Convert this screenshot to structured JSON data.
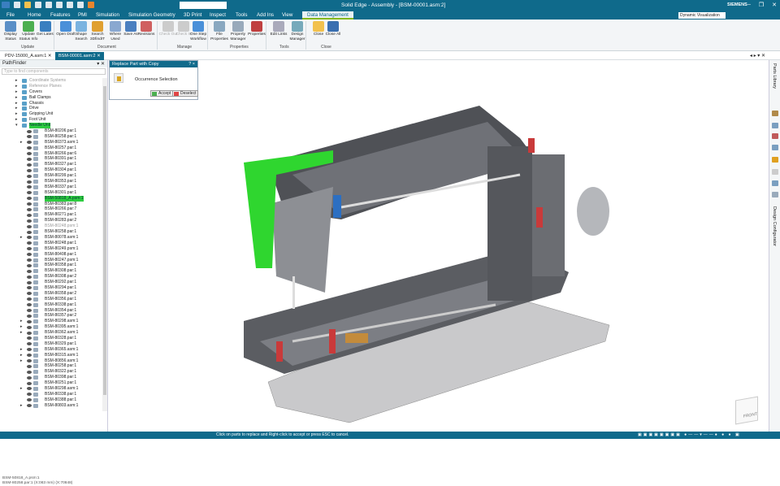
{
  "app": {
    "title": "Solid Edge - Assembly - [BSM-00001.asm:2]",
    "brand": "SIEMENS",
    "quick_search_value": ""
  },
  "menu_tabs": [
    "File",
    "Home",
    "Features",
    "PMI",
    "Simulation",
    "Simulation Geometry",
    "3D Print",
    "Inspect",
    "Tools",
    "Add Ins",
    "View",
    "Data Management"
  ],
  "active_tab": "Data Management",
  "dynamic_visualization": "Dynamic Visualization",
  "ribbon": {
    "buttons": [
      {
        "label": "Display Status",
        "icon": "display-status-icon"
      },
      {
        "label": "Update Status Info",
        "icon": "update-icon"
      },
      {
        "label": "Get Latest",
        "icon": "get-latest-icon"
      },
      {
        "label": "Open Draft",
        "icon": "open-draft-icon"
      },
      {
        "label": "Shape Search",
        "icon": "shape-search-icon"
      },
      {
        "label": "Search 3DfindIT",
        "icon": "3dfindit-icon"
      },
      {
        "label": "Where Used",
        "icon": "where-used-icon"
      },
      {
        "label": "Save As",
        "icon": "save-as-icon"
      },
      {
        "label": "Revisions",
        "icon": "revisions-icon"
      },
      {
        "label": "Check Out",
        "icon": "check-out-icon",
        "disabled": true
      },
      {
        "label": "Check In",
        "icon": "check-in-icon",
        "disabled": true
      },
      {
        "label": "One Step Workflow",
        "icon": "workflow-icon"
      },
      {
        "label": "File Properties",
        "icon": "file-properties-icon"
      },
      {
        "label": "Property Manager",
        "icon": "property-manager-icon"
      },
      {
        "label": "Properties",
        "icon": "properties-icon"
      },
      {
        "label": "Edit Links",
        "icon": "edit-links-icon"
      },
      {
        "label": "Design Manager",
        "icon": "design-manager-icon"
      },
      {
        "label": "Close",
        "icon": "close-folder-icon"
      },
      {
        "label": "Close All",
        "icon": "close-all-icon"
      }
    ],
    "groups": [
      "Update",
      "Document",
      "Manage",
      "Properties",
      "Tools",
      "Close"
    ]
  },
  "doc_tabs": [
    "PDV-15000_A.asm:1",
    "BSM-00001.asm:2"
  ],
  "pathfinder": {
    "title": "PathFinder",
    "search_placeholder": "Type to find components",
    "top_items": [
      {
        "label": "Coordinate Systems",
        "dim": true
      },
      {
        "label": "Reference Planes",
        "dim": true
      },
      {
        "label": "Covers"
      },
      {
        "label": "Ball Clamps"
      },
      {
        "label": "Chassis"
      },
      {
        "label": "Drive"
      },
      {
        "label": "Gripping Unit"
      },
      {
        "label": "Foot Unit"
      },
      {
        "label": "Needle Unit",
        "selected": true,
        "open": true
      }
    ],
    "children": [
      "BSM-80206.par:1",
      "BSM-80258.par:1",
      "BSM-80373.asm:1",
      "BSM-80257.par:1",
      "BSM-80266.par:6",
      "BSM-80391.par:1",
      "BSM-80327.par:1",
      "BSM-80304.par:1",
      "BSM-80299.par:1",
      "BSM-80353.par:1",
      "BSM-80337.par:1",
      "BSM-80301.par:1",
      "BSM-50818_A.psm:1",
      "BSM-80383.par:8",
      "BSM-80266.par:7",
      "BSM-80271.par:1",
      "BSM-80283.par:2",
      "BSM-80248.psm:1",
      "BSM-80258.par:1",
      "BSM-80078.asm:1",
      "BSM-80248.par:1",
      "BSM-80249.psm:1",
      "BSM-80408.par:1",
      "BSM-80247.psm:1",
      "BSM-80358.par:1",
      "BSM-80308.par:1",
      "BSM-80308.par:2",
      "BSM-80292.par:1",
      "BSM-80294.par:1",
      "BSM-80358.par:2",
      "BSM-80356.par:1",
      "BSM-80338.par:1",
      "BSM-80354.par:1",
      "BSM-80357.par:2",
      "BSM-80298.asm:1",
      "BSM-80395.asm:1",
      "BSM-80362.asm:1",
      "BSM-80328.par:1",
      "BSM-80329.par:1",
      "BSM-80365.asm:1",
      "BSM-80315.asm:1",
      "BSM-80856.asm:1",
      "BSM-80258.par:1",
      "BSM-80322.par:1",
      "BSM-80398.par:1",
      "BSM-80251.par:1",
      "BSM-80298.asm:1",
      "BSM-80338.par:1",
      "BSM-80388.par:1",
      "BSM-80803.asm:1"
    ],
    "selected_child": "BSM-50818_A.psm:1",
    "dim_child": "BSM-80248.psm:1",
    "bottom_lines": [
      "BSM-50818_A.psm:1",
      "BSM-80258.par:1  (X:083 mm)  (X:70848)"
    ]
  },
  "dialog": {
    "title": "Replace Part with Copy",
    "help": "?",
    "close": "×",
    "label": "Occurrence Selection",
    "accept": "Accept",
    "deselect": "Deselect"
  },
  "right_panel": {
    "parts_library": "Parts Library",
    "design_configurator": "Design Configurator"
  },
  "view_cube": {
    "face": "FRONT"
  },
  "status": {
    "prompt": "Click on parts to replace and Right-click to accept or press ESC to cancel."
  },
  "colors": {
    "brand": "#0f6a8b",
    "selection": "#2ecc40",
    "accent": "#84b818"
  }
}
